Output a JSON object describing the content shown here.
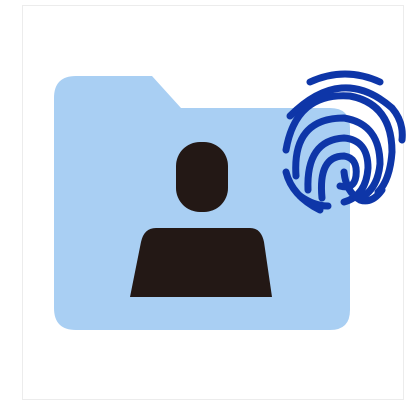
{
  "image": {
    "icon": "user-folder-fingerprint-icon",
    "parts": {
      "folder": "folder-icon",
      "person": "user-icon",
      "fingerprint": "fingerprint-icon"
    },
    "colors": {
      "background": "#ffffff",
      "frame_border": "#ececec",
      "folder_fill": "#a9cff3",
      "person_fill": "#231815",
      "fingerprint_stroke": "#0e36a8"
    }
  }
}
